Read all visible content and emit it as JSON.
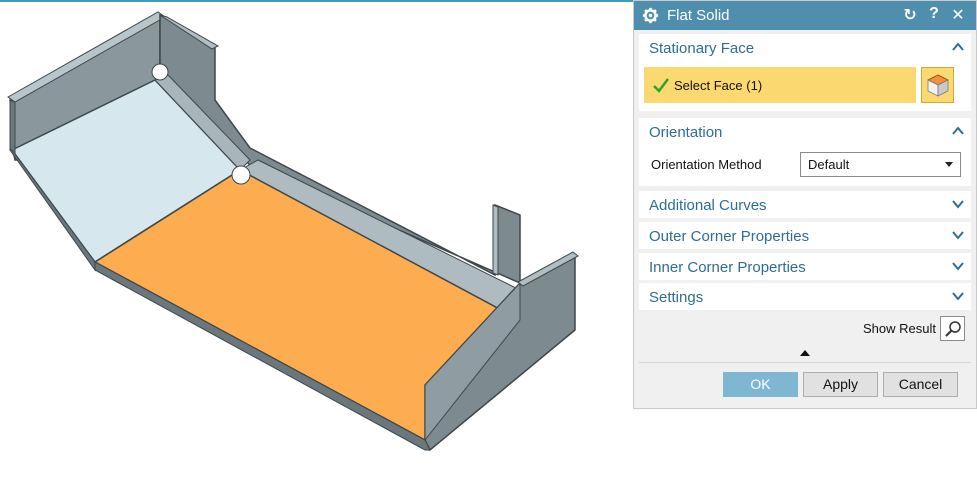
{
  "dialog": {
    "title": "Flat Solid",
    "title_icons": [
      "gear-icon",
      "reset-icon",
      "help-icon",
      "close-icon"
    ],
    "help_label": "?",
    "close_label": "✕",
    "reset_label": "↻"
  },
  "sections": {
    "stationary_face": {
      "label": "Stationary Face",
      "expanded": true,
      "select_label": "Select Face (1)",
      "select_state": "complete"
    },
    "orientation": {
      "label": "Orientation",
      "expanded": true,
      "method_label": "Orientation Method",
      "method_value": "Default"
    },
    "additional_curves": {
      "label": "Additional Curves",
      "expanded": false
    },
    "outer_corner": {
      "label": "Outer Corner Properties",
      "expanded": false
    },
    "inner_corner": {
      "label": "Inner Corner Properties",
      "expanded": false
    },
    "settings": {
      "label": "Settings",
      "expanded": false
    }
  },
  "show_result": {
    "label": "Show Result"
  },
  "buttons": {
    "ok": "OK",
    "apply": "Apply",
    "cancel": "Cancel"
  },
  "colors": {
    "title_bar": "#4f8fad",
    "section_text": "#2d6d96",
    "selected_face": "#fdac4f",
    "select_highlight": "#fbd970",
    "sheet_metal": "#7d8a90",
    "sheet_metal_light": "#d6e7ee",
    "ok_button": "#7fb7d2"
  }
}
